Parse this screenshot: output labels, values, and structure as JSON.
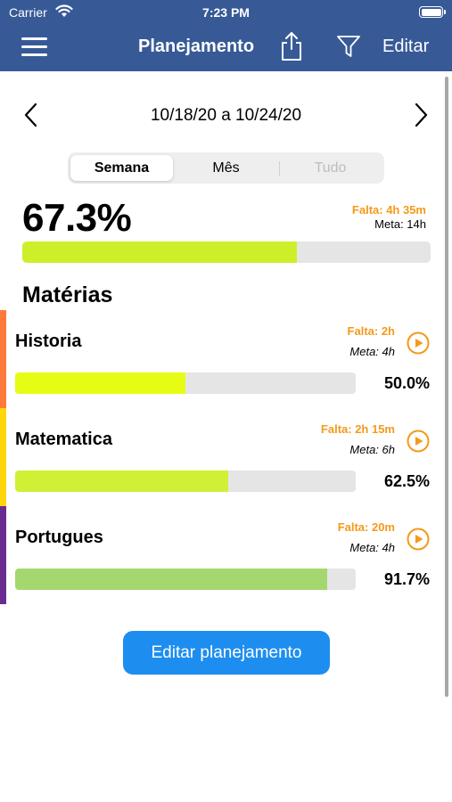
{
  "status_bar": {
    "carrier": "Carrier",
    "time": "7:23 PM"
  },
  "nav": {
    "title": "Planejamento",
    "edit_label": "Editar",
    "bar_color": "#375a97",
    "icons": {
      "menu": "hamburger-menu-icon",
      "share": "share-icon",
      "filter": "filter-funnel-icon"
    }
  },
  "period": {
    "range": "10/18/20 a 10/24/20",
    "tabs": [
      {
        "label": "Semana",
        "selected": true
      },
      {
        "label": "Mês",
        "selected": false
      },
      {
        "label": "Tudo",
        "selected": false,
        "disabled": true
      }
    ]
  },
  "overall": {
    "percent_label": "67.3%",
    "progress": 0.673,
    "falta": "Falta: 4h 35m",
    "meta": "Meta: 14h",
    "bar_color": "#ccef2a"
  },
  "section_title": "Matérias",
  "subjects": [
    {
      "name": "Historia",
      "falta": "Falta: 2h",
      "meta": "Meta: 4h",
      "percent_label": "50.0%",
      "progress": 0.5,
      "stripe_color": "#ff7a3a",
      "bar_color": "#e6fc14"
    },
    {
      "name": "Matematica",
      "falta": "Falta: 2h 15m",
      "meta": "Meta: 6h",
      "percent_label": "62.5%",
      "progress": 0.625,
      "stripe_color": "#ffd60a",
      "bar_color": "#cff034"
    },
    {
      "name": "Portugues",
      "falta": "Falta: 20m",
      "meta": "Meta: 4h",
      "percent_label": "91.7%",
      "progress": 0.917,
      "stripe_color": "#6a2c91",
      "bar_color": "#a4d86e"
    }
  ],
  "accent_orange": "#f39a1a",
  "cta": {
    "label": "Editar planejamento",
    "color": "#1d8ef0"
  }
}
